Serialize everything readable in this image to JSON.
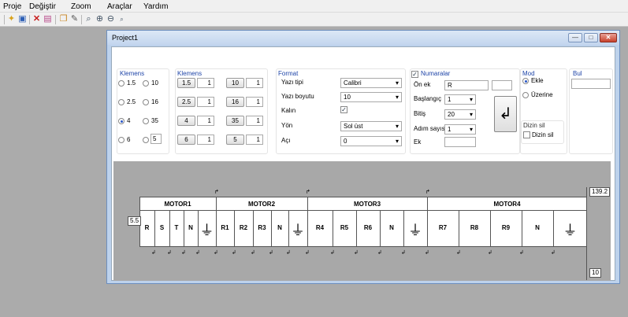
{
  "menubar": {
    "items": [
      "Proje",
      "Değiştir",
      "Zoom",
      "Araçlar",
      "Yardım"
    ]
  },
  "toolbar": {
    "icons": [
      "new-icon",
      "save-icon",
      "delete-icon",
      "export-icon",
      "copy-icon",
      "brush-icon",
      "zoom-fit-icon",
      "zoom-in-icon",
      "zoom-out-icon",
      "zoom-small-icon"
    ]
  },
  "window": {
    "title": "Project1",
    "min": "—",
    "max": "□",
    "close": "✕"
  },
  "klemens1": {
    "title": "Klemens",
    "radios": [
      "1.5",
      "10",
      "2.5",
      "16",
      "4",
      "35",
      "6"
    ],
    "custom_value": "5",
    "selected": "4"
  },
  "klemens2": {
    "title": "Klemens",
    "rows": [
      {
        "btn1": "1.5",
        "val1": "1",
        "btn2": "10",
        "val2": "1"
      },
      {
        "btn1": "2.5",
        "val1": "1",
        "btn2": "16",
        "val2": "1"
      },
      {
        "btn1": "4",
        "val1": "1",
        "btn2": "35",
        "val2": "1"
      },
      {
        "btn1": "6",
        "val1": "1",
        "btn2": "5",
        "val2": "1"
      }
    ]
  },
  "format": {
    "title": "Format",
    "font_label": "Yazı tipi",
    "font_value": "Calibri",
    "size_label": "Yazı boyutu",
    "size_value": "10",
    "bold_label": "Kalın",
    "dir_label": "Yön",
    "dir_value": "Sol üst",
    "angle_label": "Açı",
    "angle_value": "0"
  },
  "numaralar": {
    "title": "Numaralar",
    "prefix_label": "Ön ek",
    "prefix_value": "R",
    "start_label": "Başlangıç",
    "start_value": "1",
    "end_label": "Bitiş",
    "end_value": "20",
    "step_label": "Adım sayısı",
    "step_value": "1",
    "suffix_label": "Ek",
    "apply_icon": "return-arrow-icon"
  },
  "mod": {
    "title": "Mod",
    "option1": "Ekle",
    "option2": "Üzerine",
    "delete_group": "Dizin sil",
    "delete_check": "Dizin sil"
  },
  "bul": {
    "title": "Bul"
  },
  "diagram": {
    "left_measure": "5.5",
    "top_measure": "139.2",
    "bottom_measure": "10",
    "motors": [
      "MOTOR1",
      "MOTOR2",
      "MOTOR3",
      "MOTOR4"
    ],
    "terminals": [
      [
        "R",
        "S",
        "T",
        "N",
        "⏚"
      ],
      [
        "R1",
        "R2",
        "R3",
        "N",
        "⏚"
      ],
      [
        "R4",
        "R5",
        "R6",
        "N",
        "⏚"
      ],
      [
        "R7",
        "R8",
        "R9",
        "N",
        "⏚"
      ]
    ]
  }
}
